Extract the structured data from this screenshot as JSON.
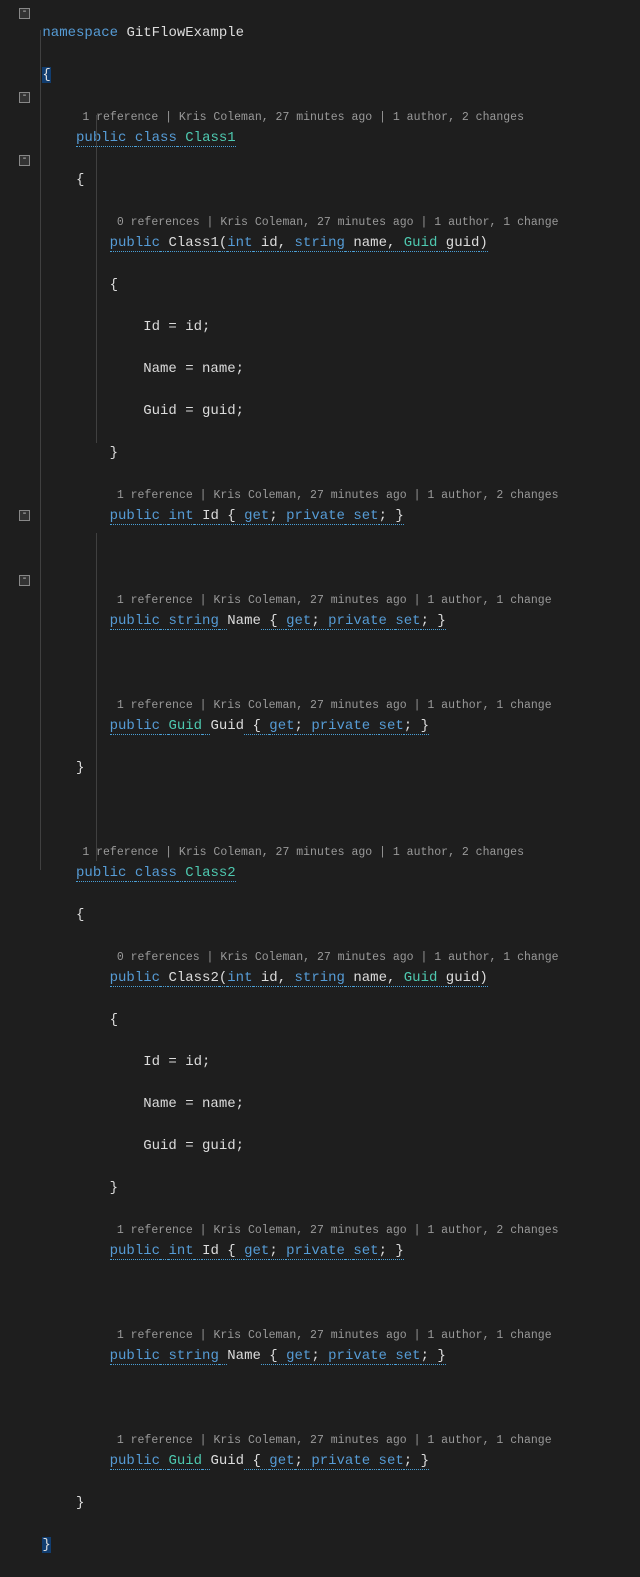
{
  "namespace_kw": "namespace",
  "namespace_name": "GitFlowExample",
  "open_brace": "{",
  "close_brace": "}",
  "fold_symbol": "-",
  "class1": {
    "codelens": "1 reference | Kris Coleman, 27 minutes ago | 1 author, 2 changes",
    "decl_public": "public",
    "decl_class": "class",
    "decl_name": "Class1",
    "ctor": {
      "codelens": "0 references | Kris Coleman, 27 minutes ago | 1 author, 1 change",
      "kw": "public",
      "name": "Class1",
      "p1_type": "int",
      "p1_name": "id",
      "p2_type": "string",
      "p2_name": "name",
      "p3_type": "Guid",
      "p3_name": "guid",
      "body1": "Id = id;",
      "body2": "Name = name;",
      "body3": "Guid = guid;"
    },
    "prop_id": {
      "codelens": "1 reference | Kris Coleman, 27 minutes ago | 1 author, 2 changes",
      "kw": "public",
      "type": "int",
      "name": "Id",
      "get": "get",
      "priv": "private",
      "set": "set"
    },
    "prop_name": {
      "codelens": "1 reference | Kris Coleman, 27 minutes ago | 1 author, 1 change",
      "kw": "public",
      "type": "string",
      "name": "Name",
      "get": "get",
      "priv": "private",
      "set": "set"
    },
    "prop_guid": {
      "codelens": "1 reference | Kris Coleman, 27 minutes ago | 1 author, 1 change",
      "kw": "public",
      "type": "Guid",
      "name": "Guid",
      "get": "get",
      "priv": "private",
      "set": "set"
    }
  },
  "class2": {
    "codelens": "1 reference | Kris Coleman, 27 minutes ago | 1 author, 2 changes",
    "decl_public": "public",
    "decl_class": "class",
    "decl_name": "Class2",
    "ctor": {
      "codelens": "0 references | Kris Coleman, 27 minutes ago | 1 author, 1 change",
      "kw": "public",
      "name": "Class2",
      "p1_type": "int",
      "p1_name": "id",
      "p2_type": "string",
      "p2_name": "name",
      "p3_type": "Guid",
      "p3_name": "guid",
      "body1": "Id = id;",
      "body2": "Name = name;",
      "body3": "Guid = guid;"
    },
    "prop_id": {
      "codelens": "1 reference | Kris Coleman, 27 minutes ago | 1 author, 2 changes",
      "kw": "public",
      "type": "int",
      "name": "Id",
      "get": "get",
      "priv": "private",
      "set": "set"
    },
    "prop_name": {
      "codelens": "1 reference | Kris Coleman, 27 minutes ago | 1 author, 1 change",
      "kw": "public",
      "type": "string",
      "name": "Name",
      "get": "get",
      "priv": "private",
      "set": "set"
    },
    "prop_guid": {
      "codelens": "1 reference | Kris Coleman, 27 minutes ago | 1 author, 1 change",
      "kw": "public",
      "type": "Guid",
      "name": "Guid",
      "get": "get",
      "priv": "private",
      "set": "set"
    }
  }
}
